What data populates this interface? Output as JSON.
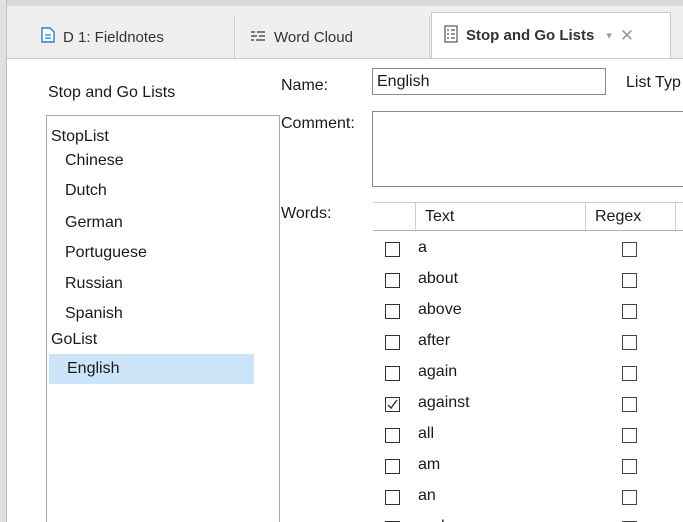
{
  "tabs": [
    {
      "label": "D 1: Fieldnotes",
      "icon": "document-icon"
    },
    {
      "label": "Word Cloud",
      "icon": "word-cloud-icon"
    },
    {
      "label": "Stop and Go Lists",
      "icon": "list-icon",
      "active": true
    }
  ],
  "tab_dropdown": "▾",
  "tab_close": "✕",
  "left_panel": {
    "title": "Stop and Go Lists",
    "tree": [
      {
        "label": "StopList",
        "type": "group"
      },
      {
        "label": "Chinese",
        "type": "child"
      },
      {
        "label": "Dutch",
        "type": "child"
      },
      {
        "label": "German",
        "type": "child"
      },
      {
        "label": "Portuguese",
        "type": "child"
      },
      {
        "label": "Russian",
        "type": "child"
      },
      {
        "label": "Spanish",
        "type": "child"
      },
      {
        "label": "GoList",
        "type": "group"
      },
      {
        "label": "English",
        "type": "child",
        "selected": true
      }
    ]
  },
  "form": {
    "name_label": "Name:",
    "name_value": "English",
    "list_type_label": "List Typ",
    "comment_label": "Comment:",
    "comment_value": "",
    "words_label": "Words:"
  },
  "table": {
    "headers": {
      "text": "Text",
      "regex": "Regex"
    },
    "rows": [
      {
        "word": "a",
        "checked": false,
        "regex": false
      },
      {
        "word": "about",
        "checked": false,
        "regex": false
      },
      {
        "word": "above",
        "checked": false,
        "regex": false
      },
      {
        "word": "after",
        "checked": false,
        "regex": false
      },
      {
        "word": "again",
        "checked": false,
        "regex": false
      },
      {
        "word": "against",
        "checked": true,
        "regex": false
      },
      {
        "word": "all",
        "checked": false,
        "regex": false
      },
      {
        "word": "am",
        "checked": false,
        "regex": false
      },
      {
        "word": "an",
        "checked": false,
        "regex": false
      },
      {
        "word": "and",
        "checked": false,
        "regex": false
      }
    ]
  },
  "colors": {
    "selection": "#cce4f7",
    "tabbar": "#efefef"
  }
}
